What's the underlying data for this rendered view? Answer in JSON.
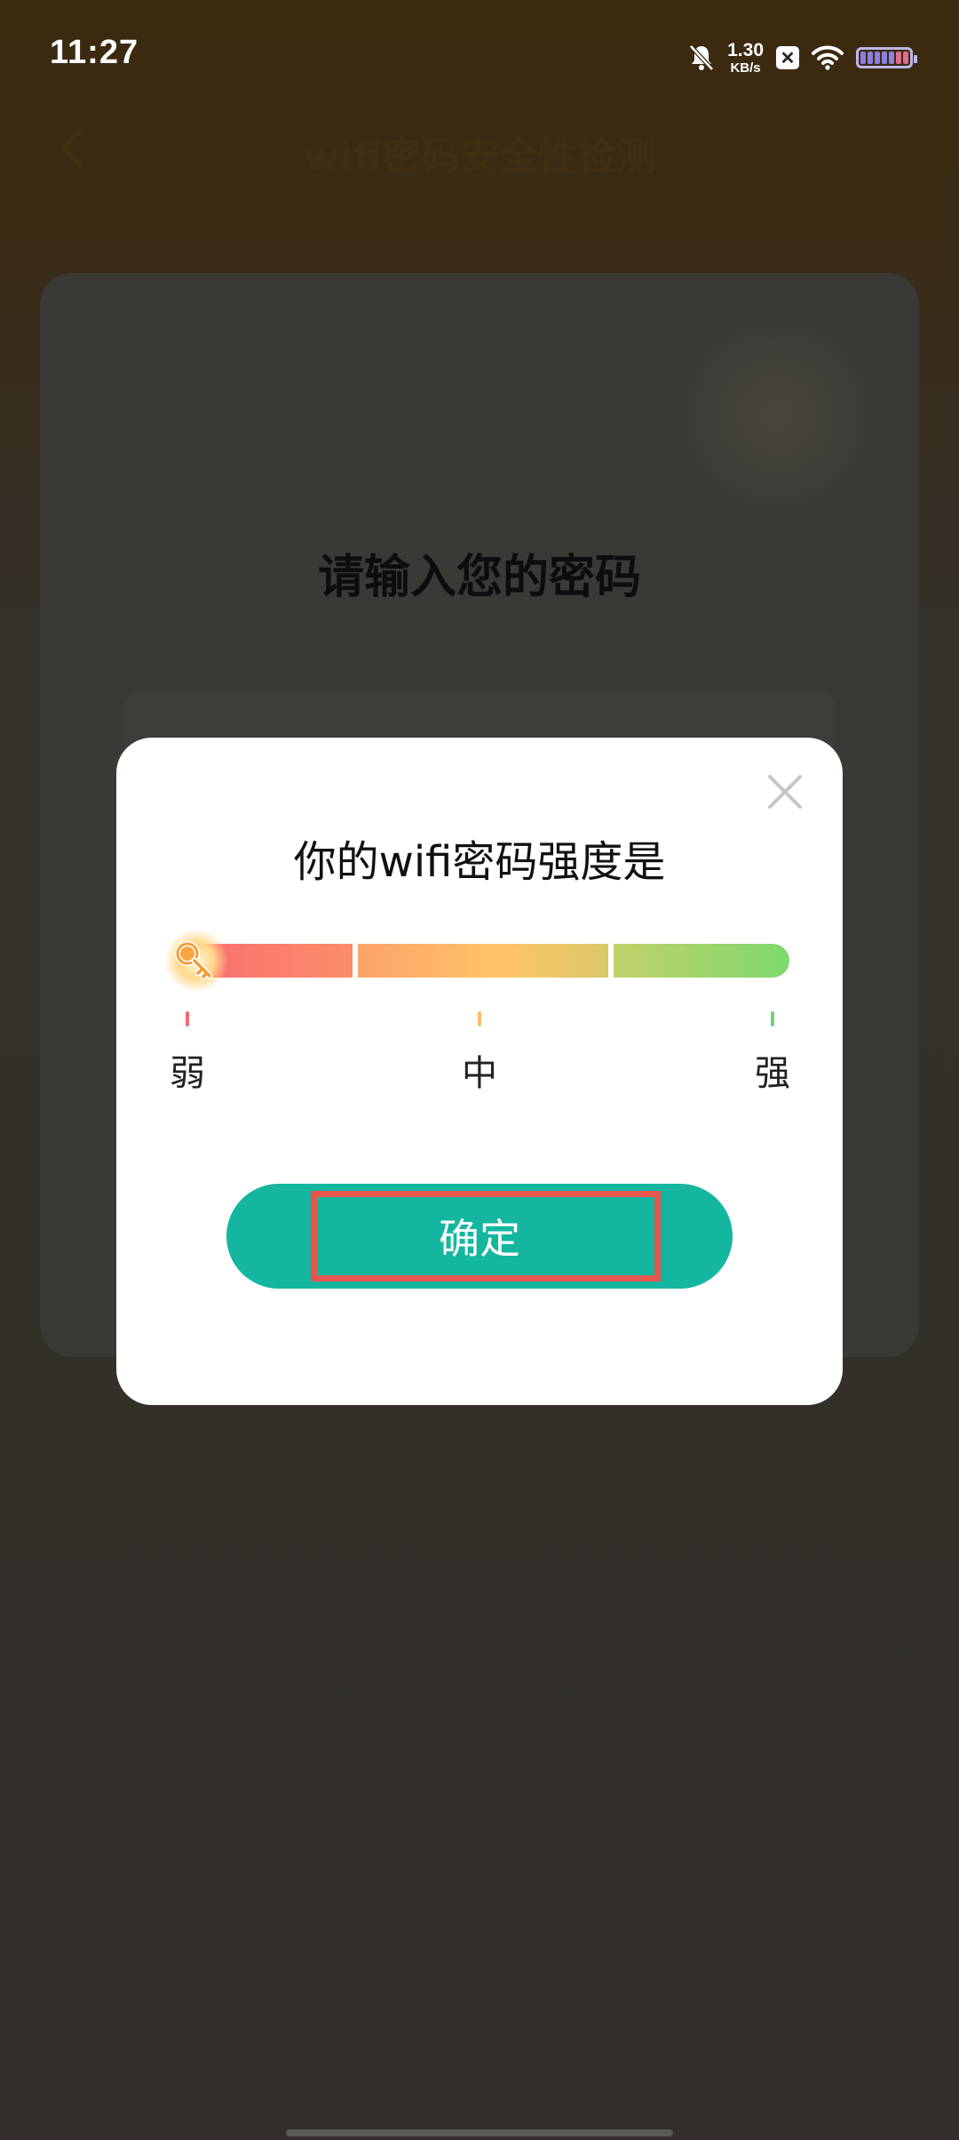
{
  "status_bar": {
    "time": "11:27",
    "net_speed_value": "1.30",
    "net_speed_unit": "KB/s",
    "icons": [
      "bell-off-icon",
      "x-badge-icon",
      "wifi-icon",
      "battery-icon"
    ]
  },
  "nav": {
    "title": "wifi密码安全性检测",
    "back_icon": "chevron-left-icon"
  },
  "main_card": {
    "prompt": "请输入您的密码"
  },
  "dialog": {
    "title": "你的wifi密码强度是",
    "close_icon": "close-icon",
    "strength_levels": [
      "弱",
      "中",
      "强"
    ],
    "level_colors": [
      "#f06b6f",
      "#fbbf66",
      "#6fd47a"
    ],
    "current_strength": "弱",
    "confirm_label": "确定"
  },
  "colors": {
    "accent": "#14b6a0",
    "highlight": "#e7564d"
  }
}
